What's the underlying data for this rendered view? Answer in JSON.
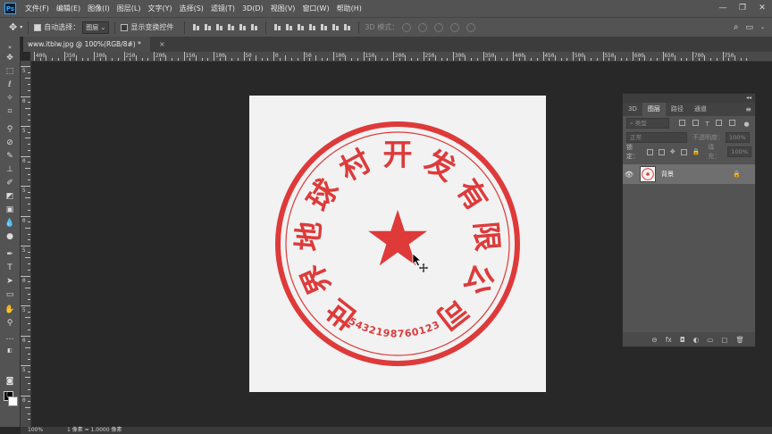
{
  "app": {
    "logo": "Ps"
  },
  "menu": [
    "文件(F)",
    "编辑(E)",
    "图像(I)",
    "图层(L)",
    "文字(Y)",
    "选择(S)",
    "滤镜(T)",
    "3D(D)",
    "视图(V)",
    "窗口(W)",
    "帮助(H)"
  ],
  "window_controls": {
    "minimize": "—",
    "restore": "❐",
    "close": "✕"
  },
  "options": {
    "auto_select_label": "自动选择：",
    "auto_select_value": "图层",
    "transform_label": "显示变换控件",
    "mode_3d_label": "3D 模式："
  },
  "document": {
    "tab_title": "www.itblw.jpg @ 100%(RGB/8#) *",
    "close": "×"
  },
  "ruler_top_labels": [
    "400",
    "350",
    "300",
    "250",
    "200",
    "150",
    "100",
    "50",
    "0",
    "50",
    "100",
    "150",
    "200",
    "250",
    "300",
    "350",
    "400",
    "450",
    "500",
    "550",
    "600",
    "650",
    "700",
    "750"
  ],
  "ruler_left_labels": [
    "5",
    "0",
    "5",
    "0",
    "5",
    "0",
    "5",
    "0",
    "5",
    "0",
    "5",
    "0"
  ],
  "seal": {
    "company_chars": [
      "世",
      "界",
      "地",
      "球",
      "村",
      "开",
      "发",
      "有",
      "限",
      "公",
      "司"
    ],
    "code": "5432198760123",
    "star": "★",
    "color": "#de3a3a"
  },
  "status": {
    "zoom": "100%",
    "info": "1 像素 = 1.0000 像素"
  },
  "layers_panel": {
    "collapse": "◂◂",
    "tabs": [
      "3D",
      "图层",
      "路径",
      "通道"
    ],
    "active_tab": "图层",
    "menu_icon": "≡",
    "filter_label": "类型",
    "blend_mode": "正常",
    "opacity_label": "不透明度：",
    "opacity_value": "100%",
    "lock_label": "锁定：",
    "fill_label": "填充：",
    "fill_value": "100%",
    "layer_name": "背景",
    "bottom_icons": [
      "⊖",
      "fx",
      "◘",
      "◐",
      "▭",
      "▢",
      "🗑"
    ]
  },
  "colors": {
    "accent": "#31a8ff",
    "seal_red": "#de3a3a"
  }
}
